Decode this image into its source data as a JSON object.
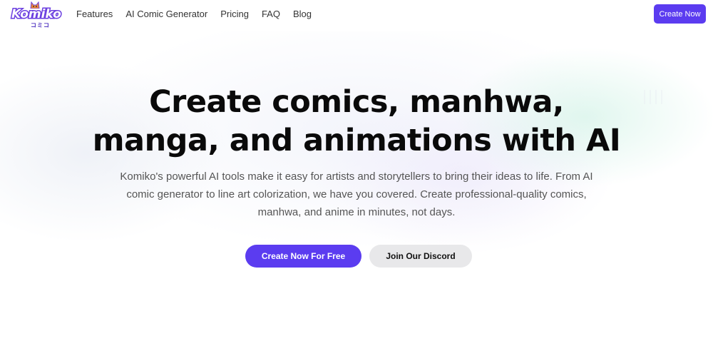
{
  "header": {
    "logo": {
      "wordmark": "Komiko",
      "subtitle": "コミコ",
      "icon": "cat-mascot-icon"
    },
    "nav": [
      {
        "label": "Features"
      },
      {
        "label": "AI Comic Generator"
      },
      {
        "label": "Pricing"
      },
      {
        "label": "FAQ"
      },
      {
        "label": "Blog"
      }
    ],
    "cta_label": "Create Now"
  },
  "hero": {
    "title_line1": "Create comics, manhwa,",
    "title_line2": "manga, and animations with AI",
    "subtitle": "Komiko's powerful AI tools make it easy for artists and storytellers to bring their ideas to life. From AI comic generator to line art colorization, we have you covered. Create professional-quality comics, manhwa, and anime in minutes, not days.",
    "primary_button": "Create Now For Free",
    "secondary_button": "Join Our Discord"
  },
  "colors": {
    "accent": "#5b3cf0",
    "secondary_button_bg": "#e8e8ea",
    "logo_purple": "#6b3fe0"
  }
}
